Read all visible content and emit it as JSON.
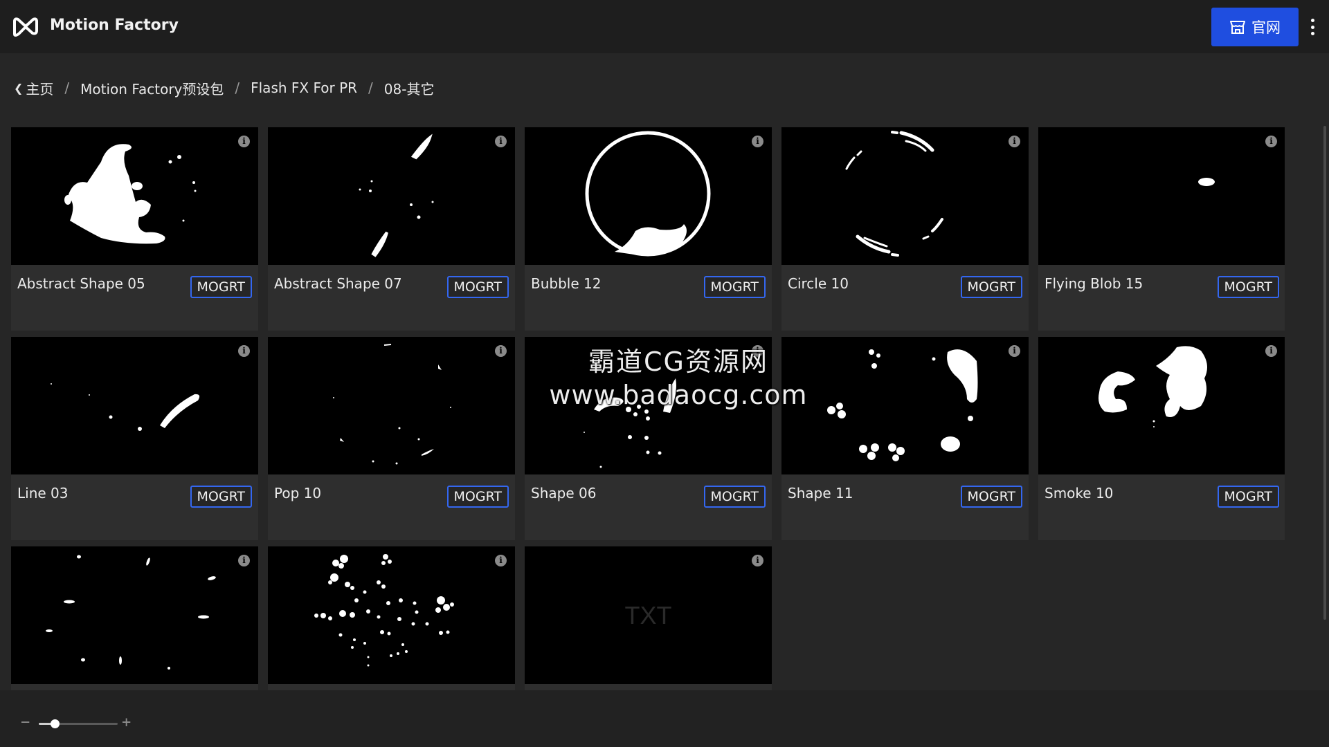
{
  "header": {
    "app_title": "Motion Factory",
    "site_button_label": "官网",
    "accent": "#1f4ee0"
  },
  "breadcrumb": {
    "back_icon": "chevron-left-icon",
    "items": [
      "主页",
      "Motion Factory预设包",
      "Flash FX For PR",
      "08-其它"
    ],
    "separator": "/"
  },
  "cards": [
    {
      "title": "Abstract Shape 05",
      "badge": "MOGRT"
    },
    {
      "title": "Abstract Shape 07",
      "badge": "MOGRT"
    },
    {
      "title": "Bubble 12",
      "badge": "MOGRT"
    },
    {
      "title": "Circle 10",
      "badge": "MOGRT"
    },
    {
      "title": "Flying Blob 15",
      "badge": "MOGRT"
    },
    {
      "title": "Line 03",
      "badge": "MOGRT"
    },
    {
      "title": "Pop 10",
      "badge": "MOGRT"
    },
    {
      "title": "Shape 06",
      "badge": "MOGRT"
    },
    {
      "title": "Shape 11",
      "badge": "MOGRT"
    },
    {
      "title": "Smoke 10",
      "badge": "MOGRT"
    },
    {
      "title": "",
      "badge": ""
    },
    {
      "title": "",
      "badge": ""
    },
    {
      "title": "",
      "badge": "",
      "thumb_text": "TXT"
    }
  ],
  "watermark": {
    "line1": "霸道CG资源网",
    "line2": "www.badaocg.com"
  },
  "footer": {
    "zoom_minus": "−",
    "zoom_plus": "+",
    "zoom_level": 0.2
  }
}
